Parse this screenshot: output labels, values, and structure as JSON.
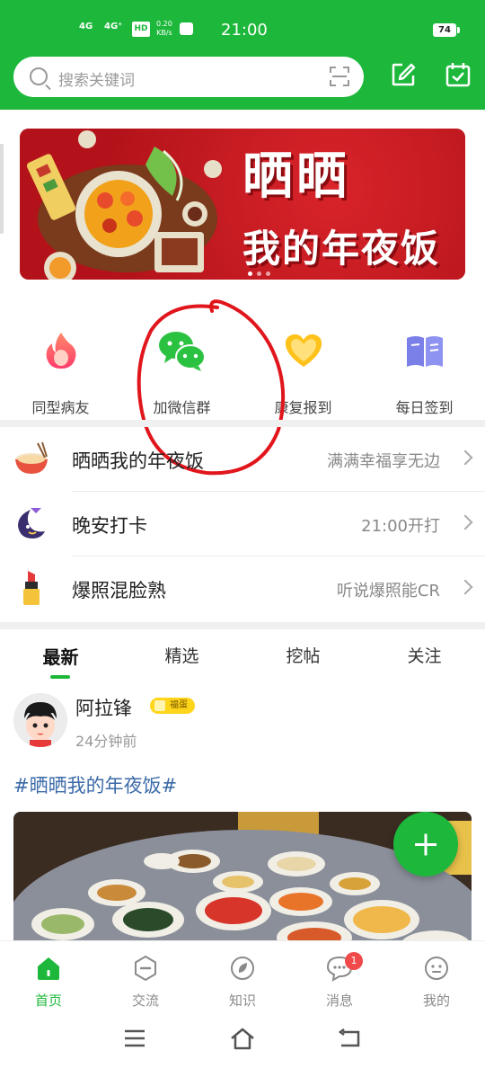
{
  "status_bar": {
    "signal1": "4G",
    "signal2": "4G⁺",
    "hd": "HD",
    "speed_value": "0.20",
    "speed_unit": "KB/s",
    "time": "21:00",
    "battery": "74"
  },
  "header": {
    "search_placeholder": "搜索关键词",
    "accent_color": "#1db83b"
  },
  "banner": {
    "title": "晒晒",
    "subtitle": "我的年夜饭",
    "page_count": 3,
    "active_page": 1
  },
  "quick_actions": [
    {
      "label": "同型病友",
      "icon": "flame-icon"
    },
    {
      "label": "加微信群",
      "icon": "wechat-icon"
    },
    {
      "label": "康复报到",
      "icon": "heart-icon"
    },
    {
      "label": "每日签到",
      "icon": "book-icon"
    }
  ],
  "topics": [
    {
      "title": "晒晒我的年夜饭",
      "subtitle": "满满幸福享无边",
      "icon": "bowl-icon"
    },
    {
      "title": "晚安打卡",
      "subtitle": "21:00开打",
      "icon": "moon-icon"
    },
    {
      "title": "爆照混脸熟",
      "subtitle": "听说爆照能CR",
      "icon": "lipstick-icon"
    }
  ],
  "feed_tabs": [
    "最新",
    "精选",
    "挖帖",
    "关注"
  ],
  "active_tab": 0,
  "post": {
    "author": "阿拉锋",
    "badge": "福蛋",
    "time_ago": "24分钟前",
    "hashtag": "#晒晒我的年夜饭#"
  },
  "bottom_nav": [
    {
      "label": "首页",
      "icon": "home-icon",
      "active": true
    },
    {
      "label": "交流",
      "icon": "chat-icon"
    },
    {
      "label": "知识",
      "icon": "knowledge-icon"
    },
    {
      "label": "消息",
      "icon": "message-icon",
      "badge": "1"
    },
    {
      "label": "我的",
      "icon": "profile-icon"
    }
  ]
}
